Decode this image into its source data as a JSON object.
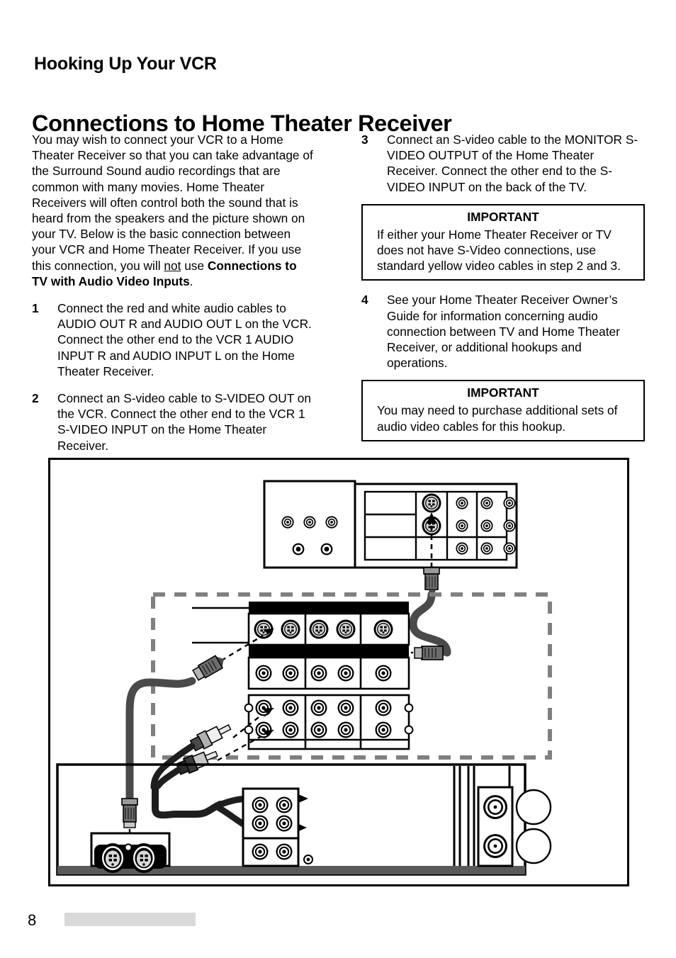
{
  "document": {
    "running_head": "Hooking Up Your VCR",
    "title": "Connections to Home Theater Receiver",
    "page_number": "8"
  },
  "left_column": {
    "intro_part1": "You may wish to connect your VCR to a Home Theater Receiver so that you can take advantage of the Surround Sound audio recordings that are common with many movies. Home Theater Receivers will often control both the sound that is heard from the speakers and the picture shown on your TV.  Below is the basic connection between your VCR and Home Theater Receiver.  If you use this connection, you will ",
    "intro_underline": "not",
    "intro_part2": " use ",
    "intro_bold": "Connections to TV with Audio Video Inputs",
    "intro_part3": ".",
    "steps": [
      {
        "number": "1",
        "text": "Connect the red and white audio cables to AUDIO OUT R and AUDIO OUT L on the VCR.  Connect the other end to the VCR 1 AUDIO INPUT R and AUDIO INPUT L on the Home Theater Receiver."
      },
      {
        "number": "2",
        "text": "Connect an S-video cable to S-VIDEO OUT on the VCR.  Connect the other end to the VCR 1 S-VIDEO INPUT on the Home Theater Receiver."
      }
    ]
  },
  "right_column": {
    "steps": [
      {
        "number": "3",
        "text": "Connect an S-video cable to the MONITOR S-VIDEO OUTPUT of the Home Theater Receiver.  Connect the other end to the S-VIDEO INPUT on the back of the TV."
      },
      {
        "number": "4",
        "text": "See your Home Theater Receiver Owner’s Guide for information concerning audio connection between TV and Home Theater Receiver, or additional hookups and operations."
      }
    ],
    "important_boxes": [
      {
        "title": "IMPORTANT",
        "body": "If either your Home Theater Receiver or TV does not have S-Video connections, use standard yellow video cables in step 2 and 3."
      },
      {
        "title": "IMPORTANT",
        "body": "You may need to purchase additional sets of audio video cables for this hookup."
      }
    ]
  },
  "diagram": {
    "description": "Hookup diagram showing TV back panel, Home Theater Receiver panel in dashed outline, and VCR back panel connected by S-video and red/white audio cables",
    "devices": [
      {
        "name": "tv-back-panel",
        "jack_groups": [
          "rca-jacks-left",
          "s-video-and-rca-grid-right"
        ]
      },
      {
        "name": "home-theater-receiver-panel",
        "jack_groups": [
          "s-video-row-5",
          "rca-row-5",
          "rca-grid-2x5"
        ]
      },
      {
        "name": "vcr-back-panel",
        "jack_groups": [
          "s-video-pair",
          "rca-grid-2x3",
          "coax-connectors"
        ]
      }
    ],
    "cables": [
      {
        "name": "s-video-cable-tv-to-receiver",
        "color": "#4a4a4a"
      },
      {
        "name": "s-video-cable-vcr-to-receiver",
        "color": "#3a3a3a"
      },
      {
        "name": "audio-cable-pair-vcr-to-receiver",
        "color": "#1a1a1a"
      }
    ]
  },
  "colors": {
    "ink": "#000000",
    "footer_bar": "#d9d9d9",
    "dashed_outline": "#808080",
    "cable_dark": "#3c3c3c",
    "plug_light": "#c8c8c8"
  }
}
